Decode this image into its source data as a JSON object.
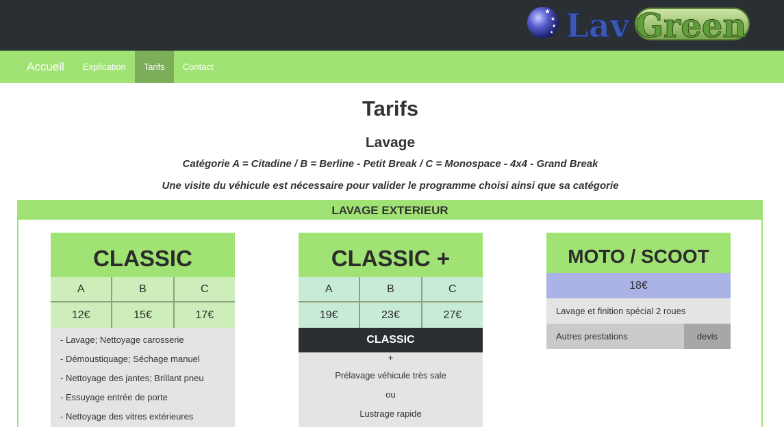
{
  "header": {
    "logo_text": "LavGreen"
  },
  "nav": {
    "brand": "Accueil",
    "items": [
      {
        "label": "Explication"
      },
      {
        "label": "Tarifs"
      },
      {
        "label": "Contact"
      }
    ],
    "active": "Tarifs"
  },
  "page": {
    "title": "Tarifs",
    "section_title": "Lavage",
    "note1": "Catégorie A = Citadine / B = Berline - Petit Break / C = Monospace - 4x4 - Grand Break",
    "note2": "Une visite du véhicule est nécessaire pour valider le programme choisi ainsi que sa catégorie"
  },
  "panel": {
    "title": "LAVAGE EXTERIEUR"
  },
  "cards": {
    "classic": {
      "title": "CLASSIC",
      "categories": [
        "A",
        "B",
        "C"
      ],
      "prices": [
        "12€",
        "15€",
        "17€"
      ],
      "features": [
        "- Lavage; Nettoyage carosserie",
        "- Démoustiquage; Séchage manuel",
        "- Nettoyage des jantes; Brillant pneu",
        "- Essuyage entrée de porte",
        "- Nettoyage des vitres extérieures"
      ]
    },
    "classic_plus": {
      "title": "CLASSIC +",
      "categories": [
        "A",
        "B",
        "C"
      ],
      "prices": [
        "19€",
        "23€",
        "27€"
      ],
      "base_label": "CLASSIC",
      "lines": [
        "+",
        "Prélavage véhicule très sale",
        "ou",
        "Lustrage rapide"
      ]
    },
    "moto": {
      "title": "MOTO / SCOOT",
      "price": "18€",
      "description": "Lavage et finition spécial 2 roues",
      "other_label": "Autres prestations",
      "other_value": "devis"
    }
  },
  "colors": {
    "nav_green": "#a0e374",
    "nav_active": "#7cad58",
    "dark": "#2a2f33",
    "moto_price": "#abb2e6"
  }
}
